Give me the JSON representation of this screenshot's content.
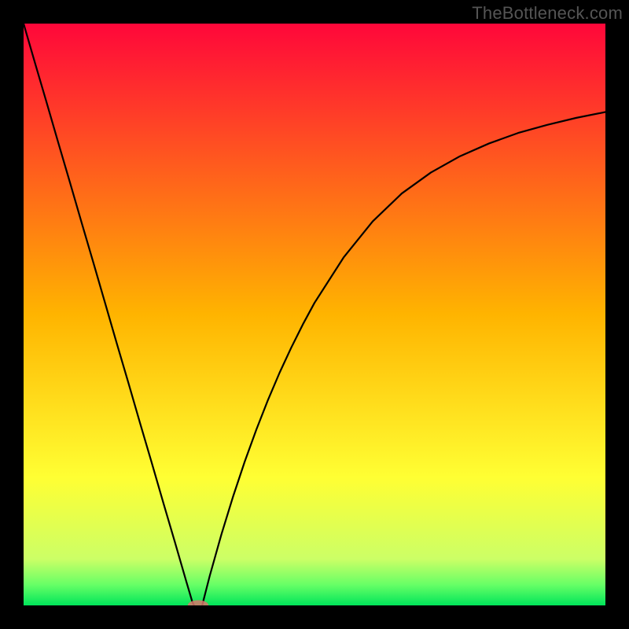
{
  "watermark": "TheBottleneck.com",
  "chart_data": {
    "type": "line",
    "title": "",
    "xlabel": "",
    "ylabel": "",
    "xlim": [
      0,
      100
    ],
    "ylim": [
      0,
      100
    ],
    "grid": false,
    "legend": false,
    "background_gradient": {
      "stops": [
        {
          "offset": 0.0,
          "color": "#ff073a"
        },
        {
          "offset": 0.5,
          "color": "#ffb400"
        },
        {
          "offset": 0.78,
          "color": "#ffff33"
        },
        {
          "offset": 0.92,
          "color": "#ccff66"
        },
        {
          "offset": 0.965,
          "color": "#66ff66"
        },
        {
          "offset": 1.0,
          "color": "#00e55a"
        }
      ]
    },
    "series": [
      {
        "name": "left-branch",
        "x": [
          0,
          2,
          4,
          6,
          8,
          10,
          12,
          14,
          16,
          18,
          20,
          22,
          24,
          26,
          28,
          28.5,
          29,
          29.3
        ],
        "values": [
          100,
          93.1,
          86.3,
          79.4,
          72.6,
          65.7,
          58.9,
          52.0,
          45.1,
          38.3,
          31.4,
          24.6,
          17.7,
          10.9,
          4.0,
          2.3,
          0.6,
          0
        ]
      },
      {
        "name": "right-branch",
        "x": [
          30.7,
          31,
          32,
          34,
          36,
          38,
          40,
          42,
          44,
          46,
          48,
          50,
          55,
          60,
          65,
          70,
          75,
          80,
          85,
          90,
          95,
          100
        ],
        "values": [
          0,
          1.2,
          5.1,
          12.2,
          18.7,
          24.7,
          30.2,
          35.3,
          40.0,
          44.3,
          48.3,
          52.0,
          59.8,
          66.0,
          70.8,
          74.4,
          77.2,
          79.4,
          81.2,
          82.6,
          83.8,
          84.8
        ]
      }
    ],
    "markers": [
      {
        "name": "minimum-marker",
        "x": 30,
        "y": 0,
        "rx": 1.8,
        "ry": 0.9,
        "fill": "#d9756b",
        "fill_opacity": 0.85
      }
    ]
  }
}
